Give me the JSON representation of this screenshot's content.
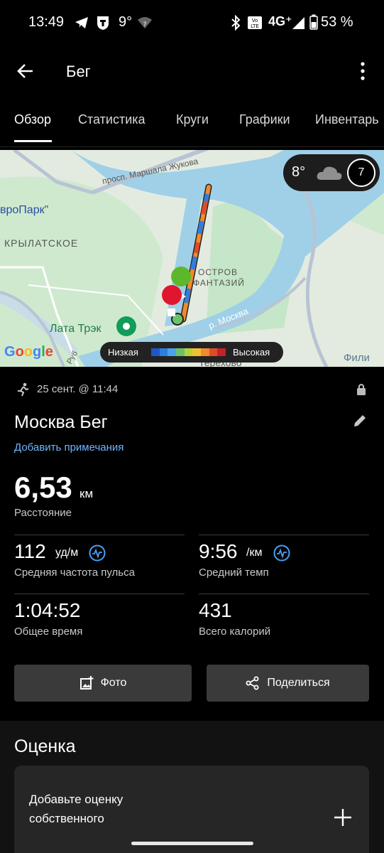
{
  "status_bar": {
    "time": "13:49",
    "temperature": "9°",
    "network": "4G⁺",
    "battery": "53 %"
  },
  "app_bar": {
    "title": "Бег"
  },
  "tabs": [
    "Обзор",
    "Статистика",
    "Круги",
    "Графики",
    "Инвентарь"
  ],
  "map": {
    "labels": {
      "street": "просп. Маршала Жукова",
      "park": "вроПарк\"",
      "district": "КРЫЛАТСКОЕ",
      "island": "ОСТРОВ\nФАНТАЗИЙ",
      "river": "р. Москва",
      "place": "Лата Трэк",
      "fili": "Фили",
      "bottom": "Терехово",
      "road": "Руб"
    },
    "brand": "Google",
    "weather": {
      "temp": "8°",
      "wind": "7"
    },
    "legend": {
      "low": "Низкая",
      "high": "Высокая",
      "colors": [
        "#1f56c8",
        "#2f7de0",
        "#4aa3ea",
        "#6bc26a",
        "#b9d23a",
        "#f0c132",
        "#f08a2c",
        "#e04a2a",
        "#c6202a"
      ]
    }
  },
  "activity": {
    "date": "25 сент. @ 11:44",
    "name": "Москва Бег",
    "add_notes": "Добавить примечания",
    "distance": {
      "value": "6,53",
      "unit": "км",
      "label": "Расстояние"
    },
    "stats": [
      {
        "value": "112",
        "unit": "уд/м",
        "label": "Средняя частота пульса",
        "wave": true
      },
      {
        "value": "9:56",
        "unit": "/км",
        "label": "Средний темп",
        "wave": true
      },
      {
        "value": "1:04:52",
        "unit": "",
        "label": "Общее время",
        "wave": false
      },
      {
        "value": "431",
        "unit": "",
        "label": "Всего калорий",
        "wave": false
      }
    ]
  },
  "buttons": {
    "photo": "Фото",
    "share": "Поделиться"
  },
  "rating": {
    "heading": "Оценка",
    "card_text": "Добавьте оценку\nсобственного"
  }
}
